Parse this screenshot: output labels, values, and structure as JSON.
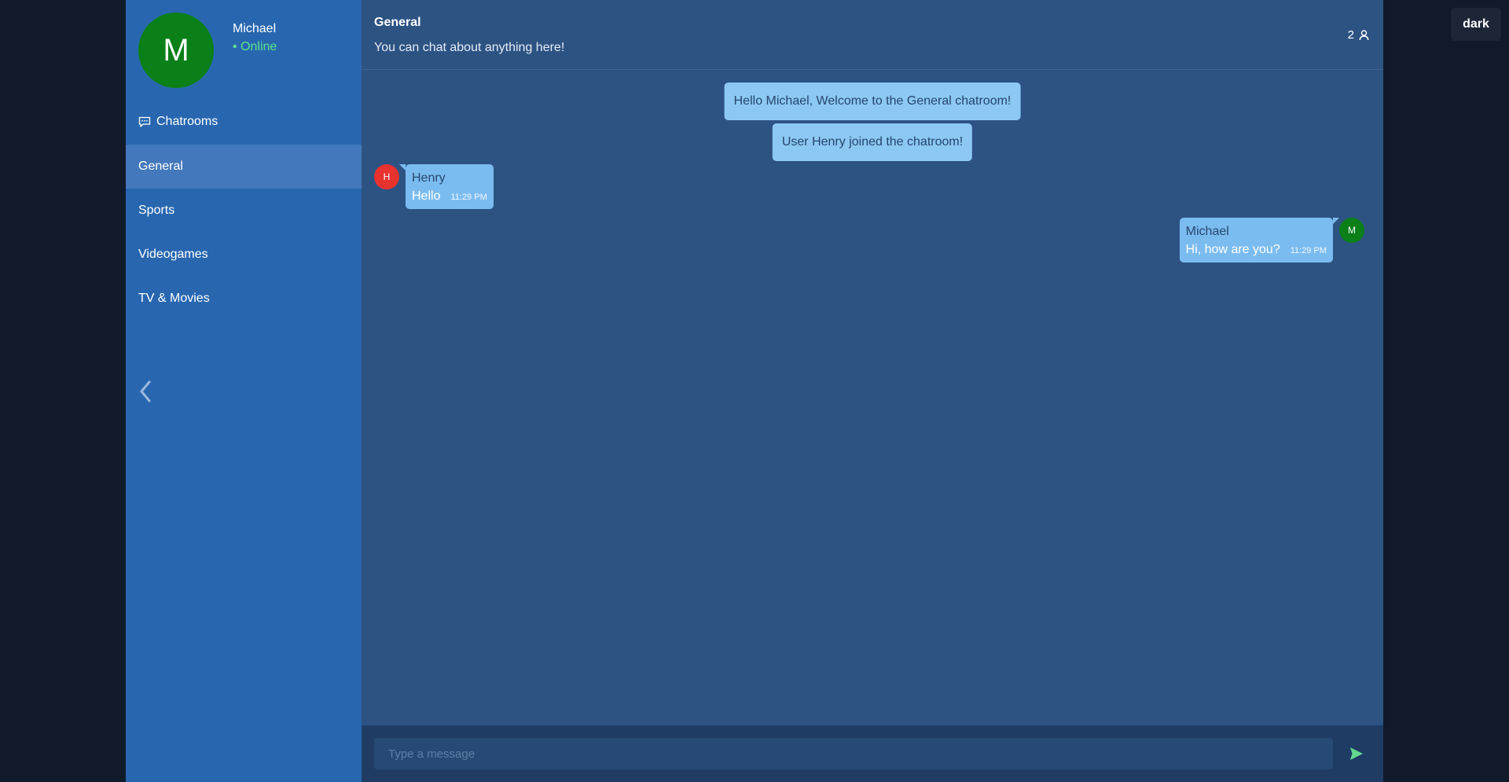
{
  "user": {
    "name": "Michael",
    "initial": "M",
    "status": "• Online"
  },
  "sidebar": {
    "section_label": "Chatrooms",
    "rooms": [
      {
        "label": "General"
      },
      {
        "label": "Sports"
      },
      {
        "label": "Videogames"
      },
      {
        "label": "TV & Movies"
      }
    ]
  },
  "chat": {
    "title": "General",
    "description": "You can chat about anything here!",
    "user_count": "2",
    "system_messages": [
      "Hello Michael, Welcome to the General chatroom!",
      "User Henry joined the chatroom!"
    ],
    "messages": [
      {
        "sender": "Henry",
        "initial": "H",
        "text": "Hello",
        "time": "11:29 PM",
        "avatar_color": "#e8322e"
      },
      {
        "sender": "Michael",
        "initial": "M",
        "text": "Hi, how are you?",
        "time": "11:29 PM",
        "avatar_color": "#0b7f18"
      }
    ]
  },
  "composer": {
    "placeholder": "Type a message"
  },
  "theme_toggle": {
    "label": "dark"
  },
  "colors": {
    "sidebar": "#2867b0",
    "main": "#2d5383",
    "bubble": "#7bbcf0",
    "online": "#5be38c",
    "send": "#63d88f"
  }
}
